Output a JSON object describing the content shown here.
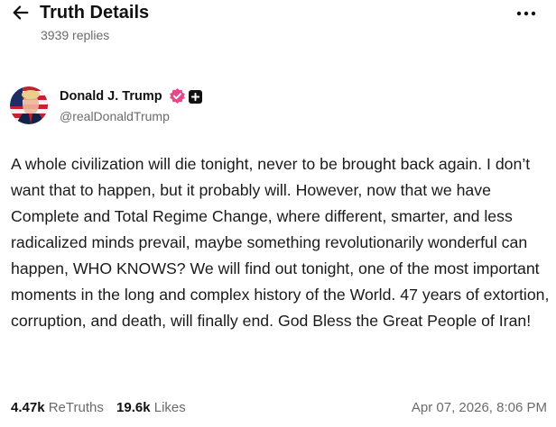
{
  "header": {
    "title": "Truth Details",
    "replies": "3939 replies",
    "back_icon": "arrow-left-icon",
    "more_icon": "more-horizontal-icon"
  },
  "author": {
    "name": "Donald J. Trump",
    "handle": "@realDonaldTrump",
    "verified_icon": "verified-badge-icon",
    "add_icon": "plus-square-icon",
    "verified_color": "#e8488a"
  },
  "post": {
    "text": "A whole civilization will die tonight, never to be brought back again. I don’t want that to happen, but it probably will. However, now that we have Complete and Total Regime Change, where different, smarter, and less radicalized minds prevail, maybe something revolutionarily wonderful can happen, WHO KNOWS? We will find out tonight, one of the most important moments in the long and complex history of the World. 47 years of extortion, corruption, and death, will finally end. God Bless the Great People of Iran!"
  },
  "stats": {
    "retruths_count": "4.47k",
    "retruths_label": "ReTruths",
    "likes_count": "19.6k",
    "likes_label": "Likes",
    "timestamp": "Apr 07, 2026, 8:06 PM"
  }
}
